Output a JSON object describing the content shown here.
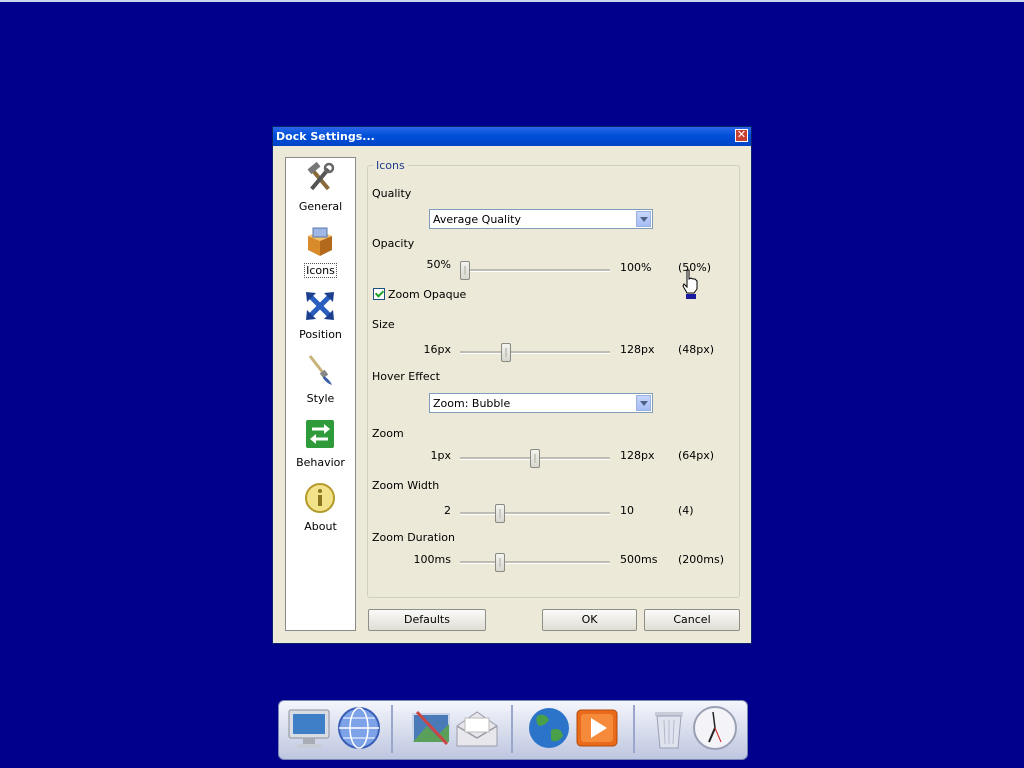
{
  "window": {
    "title": "Dock Settings...",
    "close_glyph": "✕"
  },
  "sidebar": {
    "items": [
      {
        "label": "General",
        "icon": "tools-icon"
      },
      {
        "label": "Icons",
        "icon": "box-icon",
        "active": true
      },
      {
        "label": "Position",
        "icon": "move-arrows-icon"
      },
      {
        "label": "Style",
        "icon": "paintbrush-icon"
      },
      {
        "label": "Behavior",
        "icon": "arrows-exchange-icon"
      },
      {
        "label": "About",
        "icon": "info-icon"
      }
    ]
  },
  "group": {
    "legend": "Icons"
  },
  "quality": {
    "label": "Quality",
    "value": "Average Quality"
  },
  "opacity": {
    "label": "Opacity",
    "min": "50%",
    "max": "100%",
    "current": "(50%)",
    "level": 0.0
  },
  "zoom_opaque": {
    "label": "Zoom Opaque",
    "checked": true
  },
  "size": {
    "label": "Size",
    "min": "16px",
    "max": "128px",
    "current": "(48px)",
    "level": 0.29
  },
  "hover_effect": {
    "label": "Hover Effect",
    "value": "Zoom: Bubble"
  },
  "zoom": {
    "label": "Zoom",
    "min": "1px",
    "max": "128px",
    "current": "(64px)",
    "level": 0.5
  },
  "zoom_width": {
    "label": "Zoom Width",
    "min": "2",
    "max": "10",
    "current": "(4)",
    "level": 0.25
  },
  "zoom_duration": {
    "label": "Zoom Duration",
    "min": "100ms",
    "max": "500ms",
    "current": "(200ms)",
    "level": 0.25
  },
  "buttons": {
    "defaults": "Defaults",
    "ok": "OK",
    "cancel": "Cancel"
  },
  "dock": {
    "items": [
      "monitor-icon",
      "globe-network-icon",
      "photo-edit-icon",
      "mail-envelope-icon",
      "earth-globe-icon",
      "media-player-icon",
      "recycle-bin-icon",
      "clock-icon"
    ]
  },
  "colors": {
    "desktop": "#00008c",
    "titlebar": "#0050d8",
    "dialog": "#ece9d8"
  }
}
